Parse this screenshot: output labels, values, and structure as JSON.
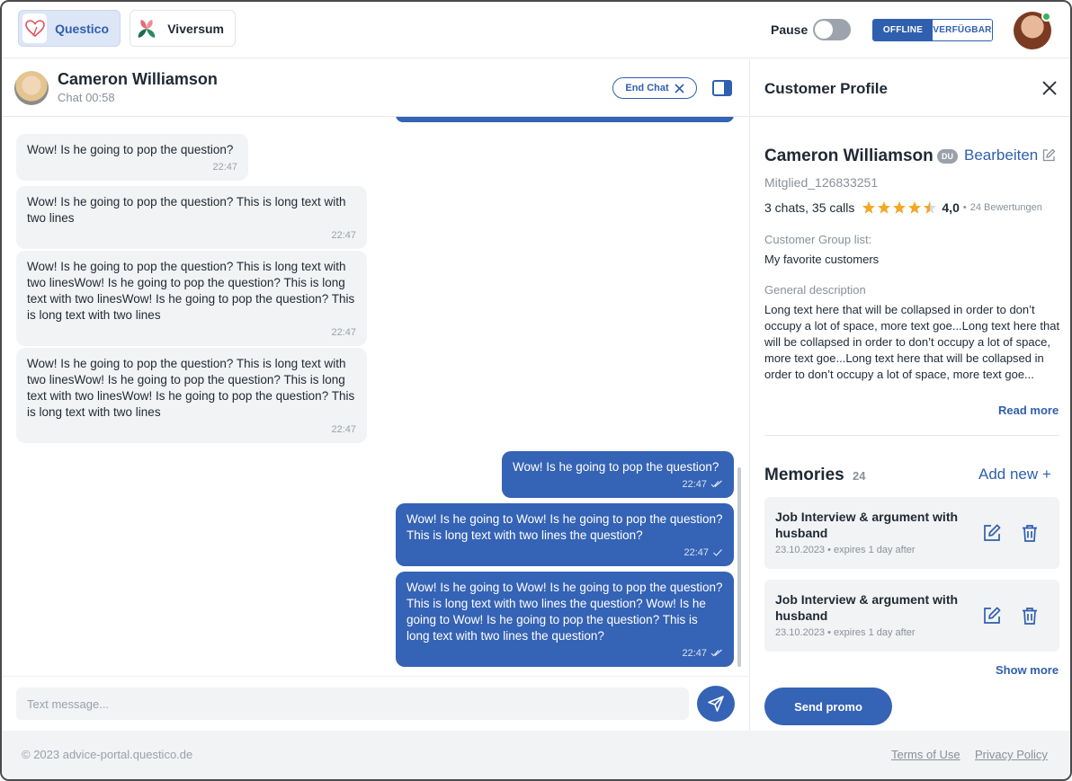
{
  "header": {
    "brands": [
      {
        "label": "Questico",
        "active": true
      },
      {
        "label": "Viversum",
        "active": false
      }
    ],
    "pause_label": "Pause",
    "status": {
      "offline": "OFFLINE",
      "available": "VERFÜGBAR",
      "selected": "OFFLINE"
    }
  },
  "chat": {
    "name": "Cameron Williamson",
    "timer": "Chat 00:58",
    "end_chat_label": "End Chat",
    "messages": [
      {
        "dir": "in",
        "text": "Wow! Is he going to pop the question?",
        "time": "22:47"
      },
      {
        "dir": "in",
        "text": "Wow! Is he going to pop the question? This is long text with two lines",
        "time": "22:47"
      },
      {
        "dir": "in",
        "text": "Wow! Is he going to pop the question? This is long text with two linesWow! Is he going to pop the question? This is long text with two linesWow! Is he going to pop the question? This is long text with two lines",
        "time": "22:47"
      },
      {
        "dir": "in",
        "text": "Wow! Is he going to pop the question? This is long text with two linesWow! Is he going to pop the question? This is long text with two linesWow! Is he going to pop the question? This is long text with two lines",
        "time": "22:47"
      },
      {
        "dir": "out",
        "text": "Wow! Is he going to pop the question?",
        "time": "22:47",
        "ticks": "double"
      },
      {
        "dir": "out",
        "text": "Wow! Is he going to Wow! Is he going to pop the question? This is long text with two lines the question?",
        "time": "22:47",
        "ticks": "single"
      },
      {
        "dir": "out",
        "text": "Wow! Is he going to Wow! Is he going to pop the question? This is long text with two lines the question? Wow! Is he going to Wow! Is he going to pop the question? This is long text with two lines the question?",
        "time": "22:47",
        "ticks": "double"
      }
    ],
    "input_placeholder": "Text message..."
  },
  "profile": {
    "title": "Customer Profile",
    "name": "Cameron Williamson",
    "badge": "DU",
    "edit_label": "Bearbeiten",
    "member_id": "Mitglied_126833251",
    "stats": "3 chats, 35 calls",
    "rating_value": 4.5,
    "rating_text": "4,0",
    "rating_separator": "•",
    "rating_count": "24 Bewertungen",
    "group_label": "Customer Group list:",
    "group_value": "My favorite customers",
    "description_label": "General description",
    "description": "Long text here that will be collapsed in order to don’t occupy a lot of space, more text goe...Long text here that will be collapsed in order to don’t occupy a lot of space, more text goe...Long text here that will be collapsed in order to don’t occupy a lot of space, more text goe...",
    "read_more": "Read more",
    "memories_title": "Memories",
    "memories_count": "24",
    "add_new": "Add new +",
    "memories": [
      {
        "title": "Job Interview & argument with husband",
        "date": "23.10.2023",
        "separator": "•",
        "expires": "expires 1 day after"
      },
      {
        "title": "Job Interview & argument with husband",
        "date": "23.10.2023",
        "separator": "•",
        "expires": "expires 1 day after"
      }
    ],
    "show_more": "Show more",
    "promo_label": "Send promo"
  },
  "footer": {
    "copyright": "© 2023 advice-portal.questico.de",
    "terms": "Terms of Use",
    "privacy": "Privacy Policy"
  },
  "colors": {
    "primary": "#3563b5",
    "accent_star": "#f5a623",
    "online": "#3cb25b"
  }
}
